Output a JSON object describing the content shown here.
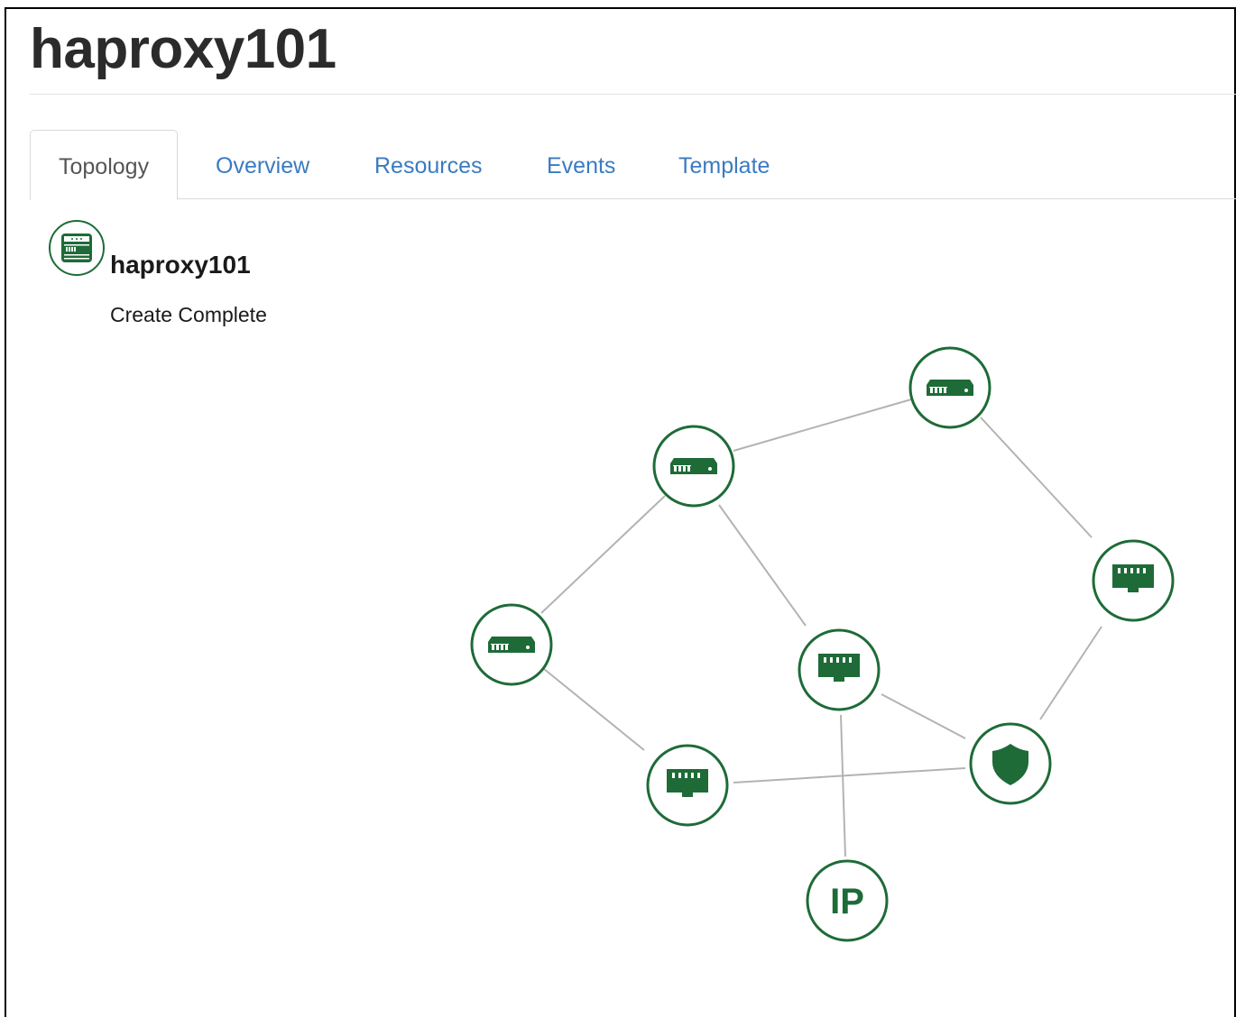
{
  "page": {
    "title": "haproxy101"
  },
  "tabs": [
    {
      "label": "Topology",
      "active": true
    },
    {
      "label": "Overview",
      "active": false
    },
    {
      "label": "Resources",
      "active": false
    },
    {
      "label": "Events",
      "active": false
    },
    {
      "label": "Template",
      "active": false
    }
  ],
  "stack": {
    "name": "haproxy101",
    "status": "Create Complete",
    "icon": "stack-server-icon"
  },
  "colors": {
    "accent_green": "#1e6b38",
    "link_blue": "#3a7bc0",
    "edge_gray": "#b3b3b3"
  },
  "topology": {
    "nodes": [
      {
        "id": "server-top",
        "icon": "server-icon"
      },
      {
        "id": "server-mid",
        "icon": "server-icon"
      },
      {
        "id": "server-left",
        "icon": "server-icon"
      },
      {
        "id": "port-right",
        "icon": "port-icon"
      },
      {
        "id": "port-center",
        "icon": "port-icon"
      },
      {
        "id": "port-bottom",
        "icon": "port-icon"
      },
      {
        "id": "secgroup",
        "icon": "shield-icon"
      },
      {
        "id": "floating-ip",
        "icon": "ip-icon",
        "label": "IP"
      }
    ],
    "edges": [
      [
        "server-mid",
        "server-top"
      ],
      [
        "server-top",
        "port-right"
      ],
      [
        "server-mid",
        "server-left"
      ],
      [
        "server-mid",
        "port-center"
      ],
      [
        "server-left",
        "port-bottom"
      ],
      [
        "port-right",
        "secgroup"
      ],
      [
        "port-center",
        "secgroup"
      ],
      [
        "port-bottom",
        "secgroup"
      ],
      [
        "port-center",
        "floating-ip"
      ]
    ]
  }
}
